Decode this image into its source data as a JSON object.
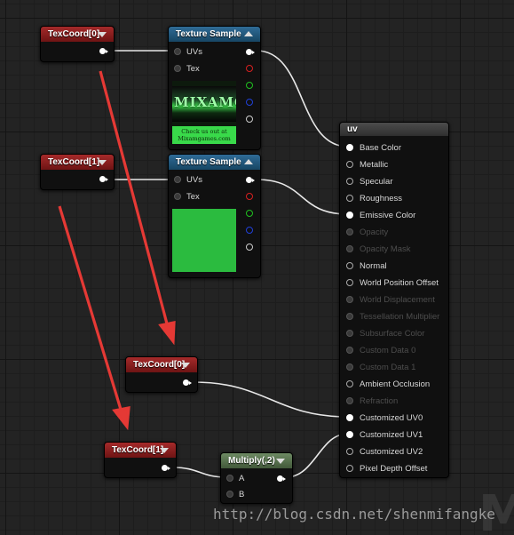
{
  "nodes": {
    "texcoord_a": {
      "title": "TexCoord[0]"
    },
    "texcoord_b": {
      "title": "TexCoord[1]"
    },
    "texcoord_c": {
      "title": "TexCoord[0]"
    },
    "texcoord_d": {
      "title": "TexCoord[1]"
    },
    "texture_sample_1": {
      "title": "Texture Sample",
      "inputs": [
        "UVs",
        "Tex"
      ],
      "thumbnail_text": "Check us out at Mixamgames.com",
      "thumbnail_logo": "MIXAMO"
    },
    "texture_sample_2": {
      "title": "Texture Sample",
      "inputs": [
        "UVs",
        "Tex"
      ]
    },
    "multiply": {
      "title": "Multiply(,2)",
      "inputs": [
        "A",
        "B"
      ]
    },
    "material": {
      "title": "uv",
      "pins": [
        {
          "label": "Base Color",
          "state": "connected"
        },
        {
          "label": "Metallic",
          "state": "active"
        },
        {
          "label": "Specular",
          "state": "active"
        },
        {
          "label": "Roughness",
          "state": "active"
        },
        {
          "label": "Emissive Color",
          "state": "connected"
        },
        {
          "label": "Opacity",
          "state": "disabled"
        },
        {
          "label": "Opacity Mask",
          "state": "disabled"
        },
        {
          "label": "Normal",
          "state": "active"
        },
        {
          "label": "World Position Offset",
          "state": "active"
        },
        {
          "label": "World Displacement",
          "state": "disabled"
        },
        {
          "label": "Tessellation Multiplier",
          "state": "disabled"
        },
        {
          "label": "Subsurface Color",
          "state": "disabled"
        },
        {
          "label": "Custom Data 0",
          "state": "disabled"
        },
        {
          "label": "Custom Data 1",
          "state": "disabled"
        },
        {
          "label": "Ambient Occlusion",
          "state": "active"
        },
        {
          "label": "Refraction",
          "state": "disabled"
        },
        {
          "label": "Customized UV0",
          "state": "connected"
        },
        {
          "label": "Customized UV1",
          "state": "connected"
        },
        {
          "label": "Customized UV2",
          "state": "active"
        },
        {
          "label": "Pixel Depth Offset",
          "state": "active"
        }
      ]
    }
  },
  "colors": {
    "canvas": "#232323",
    "header_texcoord": "#8b1e1e",
    "header_texture": "#245a80",
    "header_multiply": "#5a7450",
    "annotation_arrow": "#e53935",
    "channel_r": "#d62020",
    "channel_g": "#20c020",
    "channel_b": "#2040d8",
    "channel_a": "#cccccc"
  },
  "watermark": "http://blog.csdn.net/shenmifangke"
}
